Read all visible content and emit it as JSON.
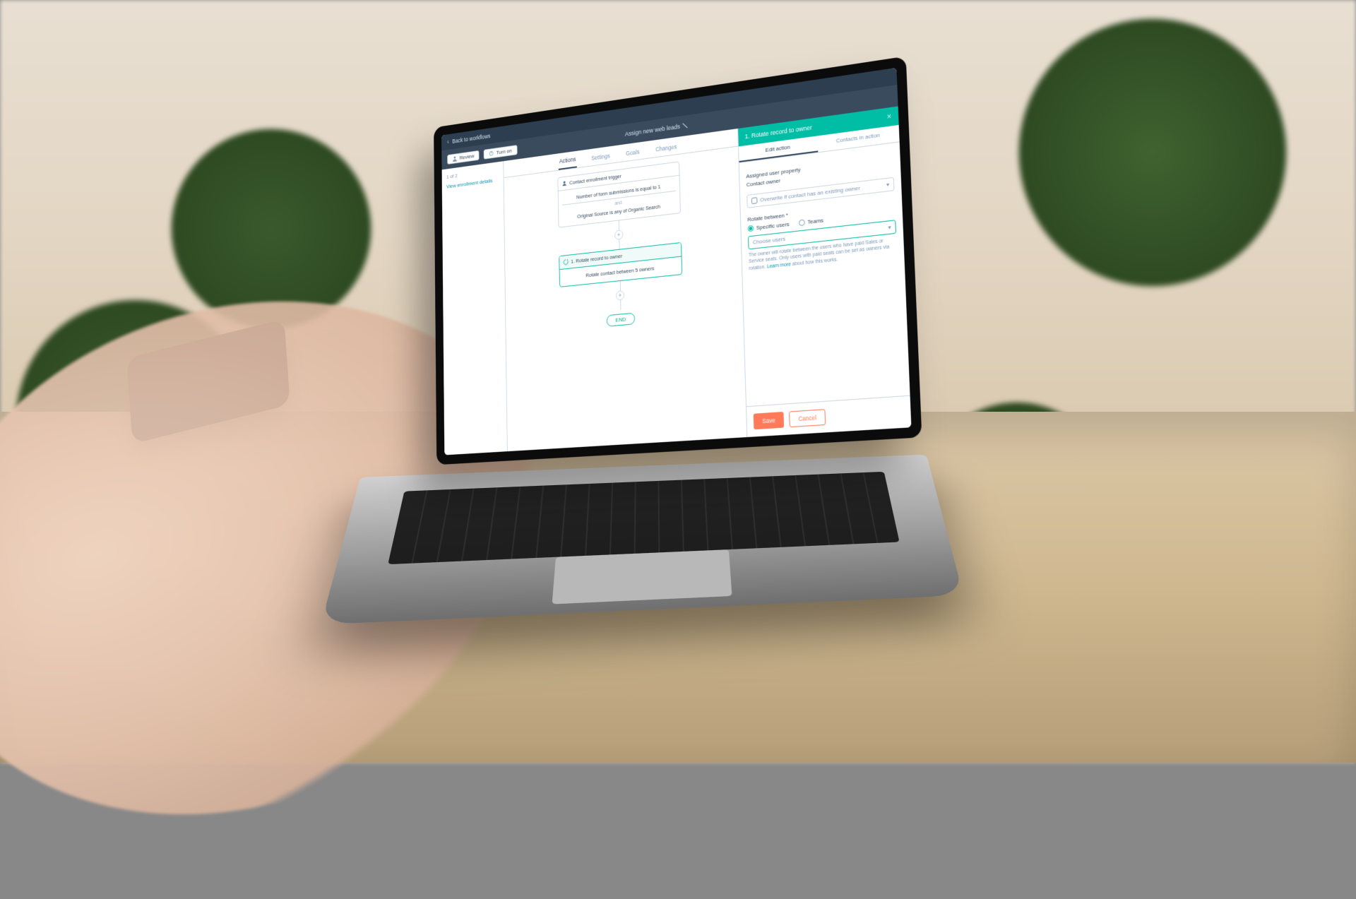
{
  "topbar": {
    "back": "Back to workflows"
  },
  "subbar": {
    "title": "Assign new web leads",
    "pills": [
      "Review",
      "Turn on"
    ]
  },
  "left": {
    "viewing": "1 of 2",
    "link": "View enrollment details"
  },
  "tabs": [
    "Actions",
    "Settings",
    "Goals",
    "Changes"
  ],
  "activeTab": 0,
  "flow": {
    "trigger": {
      "head": "Contact enrollment trigger",
      "line1": "Number of form submissions is equal to 1",
      "and": "and",
      "line2": "Original Source is any of Organic Search"
    },
    "action": {
      "head": "1. Rotate record to owner",
      "body": "Rotate contact between 5 owners"
    },
    "end": "END"
  },
  "panel": {
    "title": "1. Rotate record to owner",
    "tabs": [
      "Edit action",
      "Contacts in action"
    ],
    "activeTab": 0,
    "assignLabel": "Assigned user property",
    "assignValue": "Contact owner",
    "overwrite": "Overwrite if contact has an existing owner",
    "rotateLabel": "Rotate between *",
    "radios": [
      "Specific users",
      "Teams"
    ],
    "radioOn": 0,
    "chooseUsers": "Choose users",
    "helpText": "The owner will rotate between the users who have paid Sales or Service seats. Only users with paid seats can be set as owners via rotation. ",
    "helpLink": "Learn more",
    "helpTail": " about how this works.",
    "save": "Save",
    "cancel": "Cancel"
  }
}
